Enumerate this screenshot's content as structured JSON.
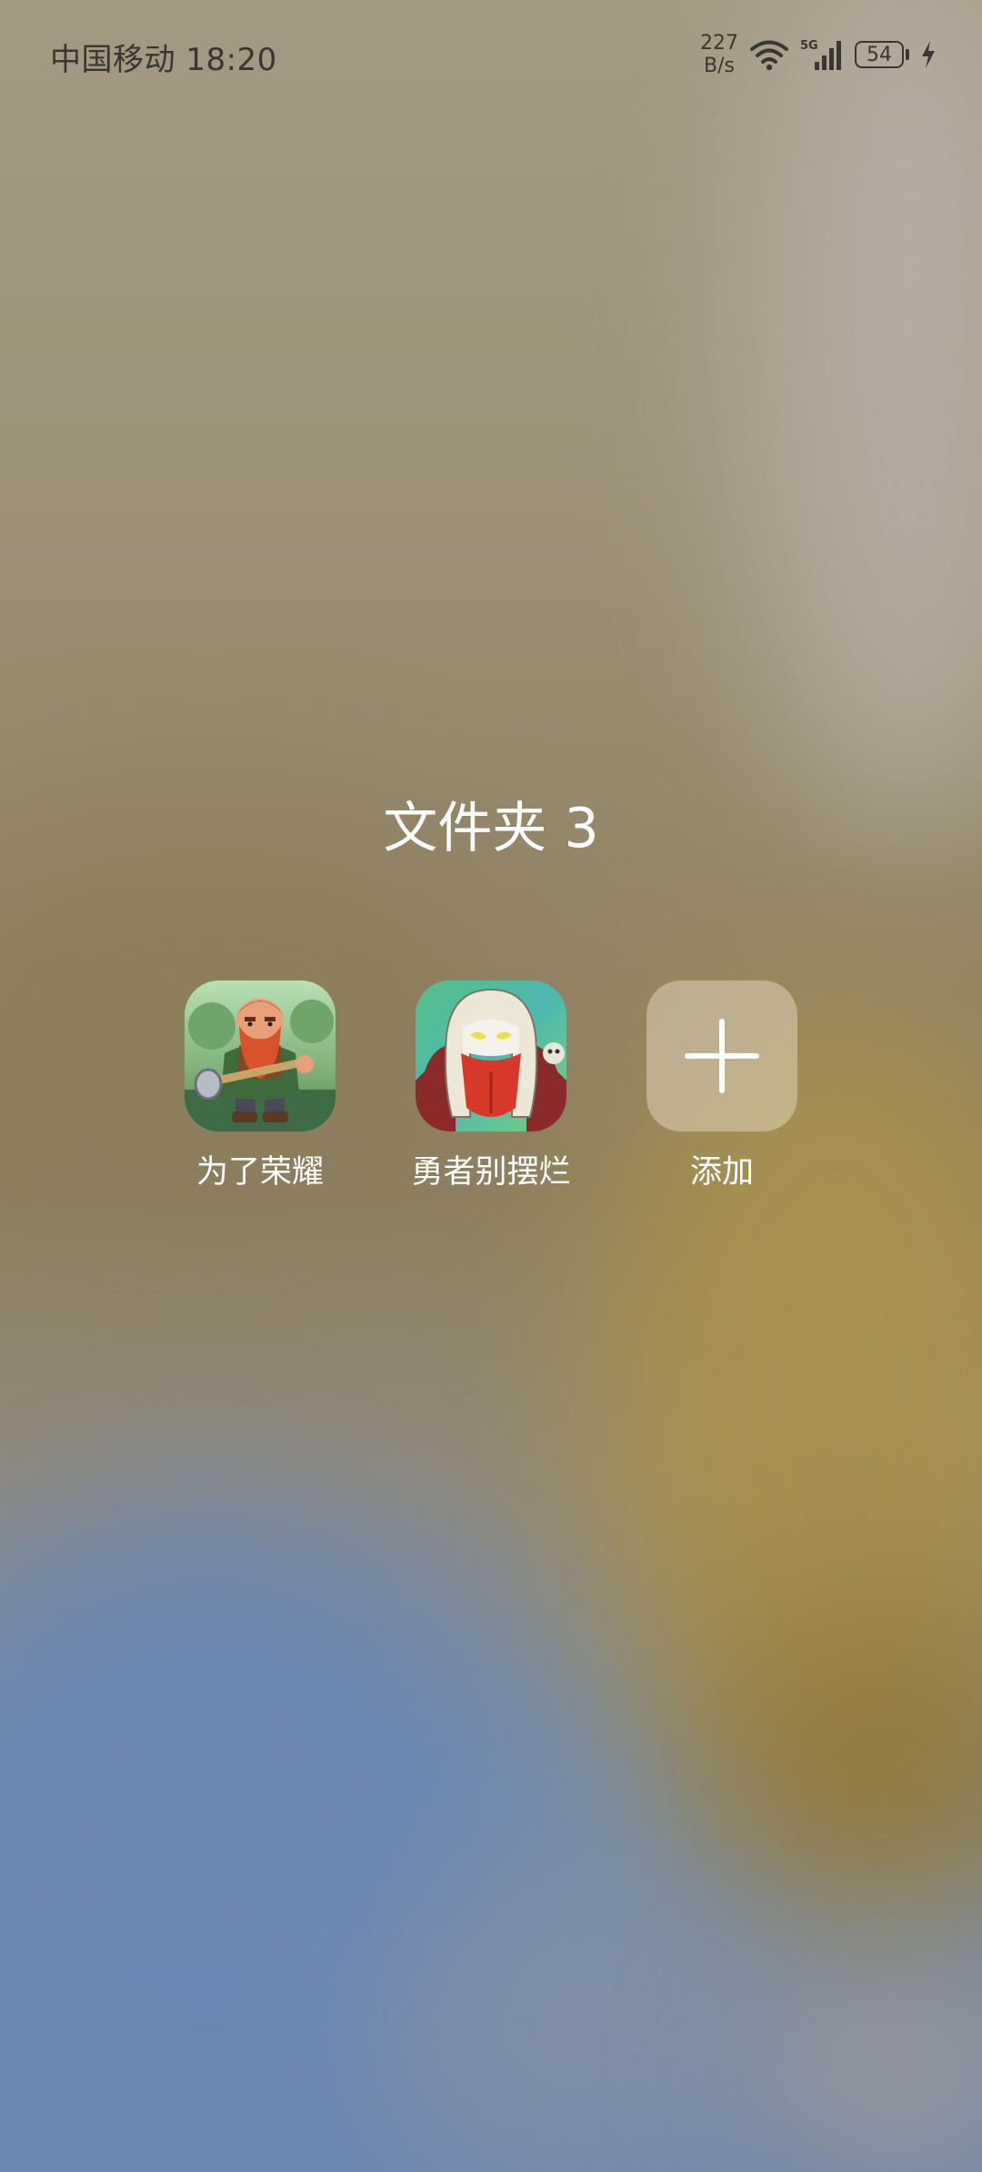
{
  "status_bar": {
    "carrier_time": "中国移动 18:20",
    "net_speed_value": "227",
    "net_speed_unit": "B/s",
    "signal_label": "5G",
    "battery": "54",
    "icons": [
      "wifi-icon",
      "signal-5g-icon",
      "battery-icon",
      "charging-bolt-icon"
    ]
  },
  "folder": {
    "title": "文件夹 3",
    "apps": [
      {
        "label": "为了荣耀",
        "icon": "dwarf-warrior-game-icon"
      },
      {
        "label": "勇者别摆烂",
        "icon": "masked-knight-game-icon"
      }
    ],
    "add_button": {
      "label": "添加",
      "icon": "plus-icon"
    }
  }
}
